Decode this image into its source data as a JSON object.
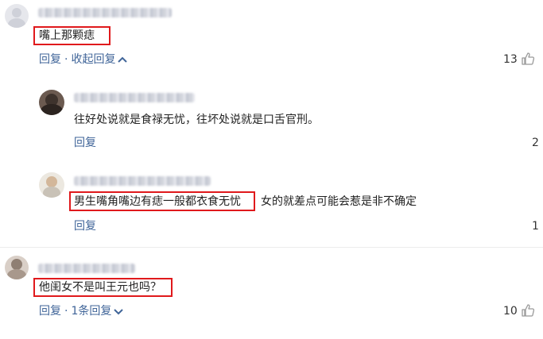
{
  "comments": [
    {
      "text": "嘴上那颗痣",
      "reply_label": "回复",
      "collapse_label": "收起回复",
      "like_count": "13"
    },
    {
      "text": "往好处说就是食禄无忧，往坏处说就是口舌官刑。",
      "reply_label": "回复",
      "like_count": "2"
    },
    {
      "text_highlight": "男生嘴角嘴边有痣一般都衣食无忧",
      "text_rest": "女的就差点可能会惹是非不确定",
      "reply_label": "回复",
      "like_count": "1"
    },
    {
      "text": "他闺女不是叫王元也吗？",
      "reply_label": "回复",
      "replies_label": "1条回复",
      "like_count": "10"
    }
  ],
  "colors": {
    "highlight_box": "#e0191c",
    "link": "#406599",
    "divider": "#ececec"
  }
}
